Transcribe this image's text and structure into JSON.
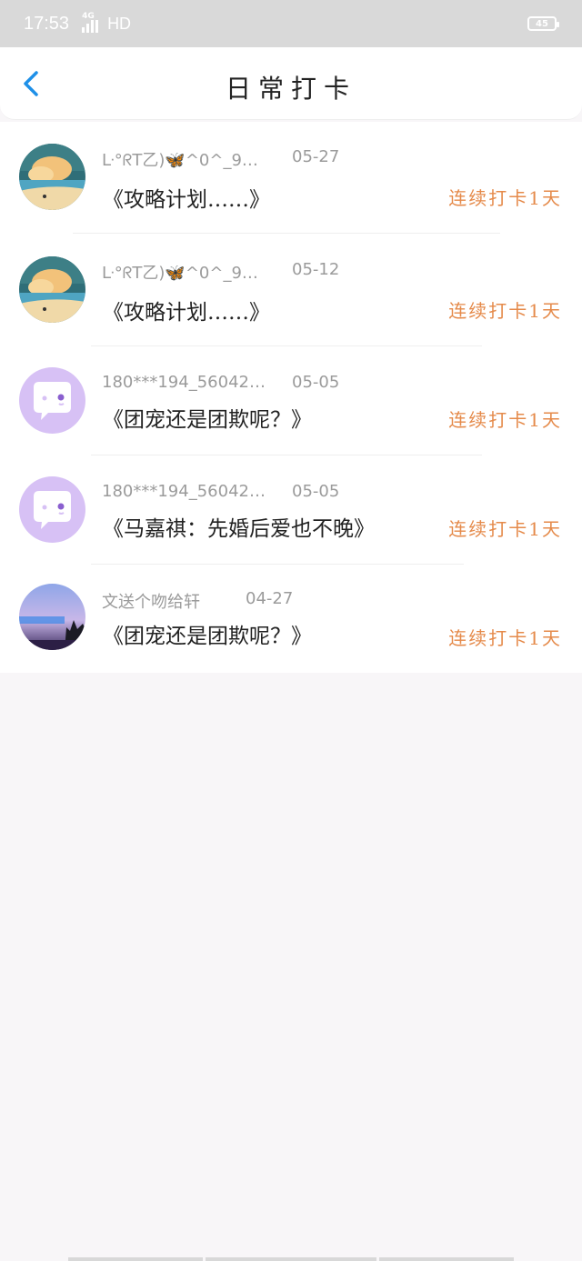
{
  "status": {
    "time": "17:53",
    "network": "4G",
    "hd": "HD",
    "battery": "45"
  },
  "header": {
    "title": "日常打卡"
  },
  "items": [
    {
      "username": "ᒷ°ᖇT乙)🦋^0^_9…",
      "date": "05-27",
      "topic": "《攻略计划……》",
      "streak": "连续打卡1天",
      "avatar": "beach-illustration"
    },
    {
      "username": "ᒷ°ᖇT乙)🦋^0^_9…",
      "date": "05-12",
      "topic": "《攻略计划……》",
      "streak": "连续打卡1天",
      "avatar": "beach-illustration"
    },
    {
      "username": "180***194_56042…",
      "date": "05-05",
      "topic": "《团宠还是团欺呢？》",
      "streak": "连续打卡1天",
      "avatar": "default-chat-bubble"
    },
    {
      "username": "180***194_56042…",
      "date": "05-05",
      "topic": "《马嘉祺：先婚后爱也不晚》",
      "streak": "连续打卡1天",
      "avatar": "default-chat-bubble"
    },
    {
      "username": "文送个吻给轩",
      "date": "04-27",
      "topic": "《团宠还是团欺呢？》",
      "streak": "连续打卡1天",
      "avatar": "sunset-photo"
    }
  ],
  "colors": {
    "accent": "#1e90e8",
    "streak": "#e58a4a",
    "meta": "#9b9b9b",
    "default_avatar": "#d7c1f5"
  }
}
